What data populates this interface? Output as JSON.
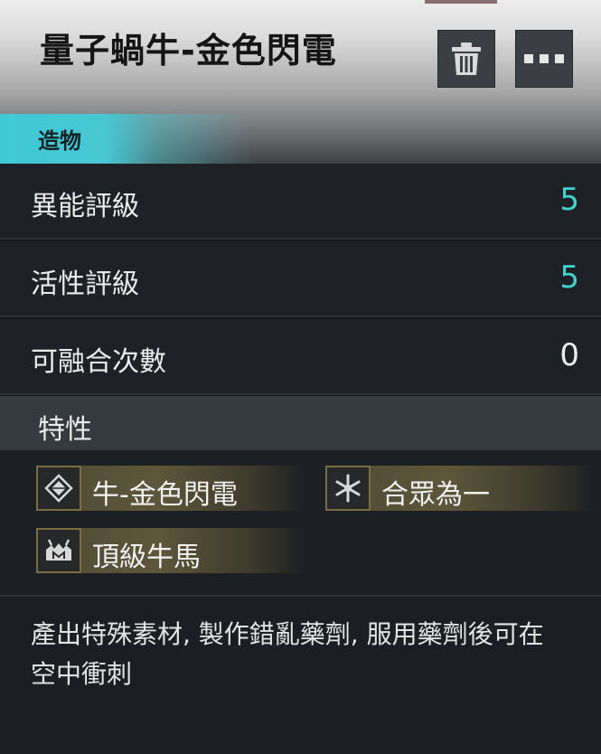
{
  "item": {
    "title": "量子蝸牛-金色閃電",
    "category": "造物"
  },
  "header_buttons": [
    {
      "name": "delete",
      "icon": "trash-icon"
    },
    {
      "name": "more",
      "icon": "more-dots-icon"
    }
  ],
  "stats": [
    {
      "label": "異能評級",
      "value": "5",
      "highlight": true
    },
    {
      "label": "活性評級",
      "value": "5",
      "highlight": true
    },
    {
      "label": "可融合次數",
      "value": "0",
      "highlight": false
    }
  ],
  "traits": {
    "heading": "特性",
    "items": [
      {
        "label": "牛-金色閃電",
        "icon": "diamond-icon"
      },
      {
        "label": "合眾為一",
        "icon": "snowflake-icon"
      },
      {
        "label": "頂級牛馬",
        "icon": "cow-icon"
      }
    ]
  },
  "description": "產出特殊素材, 製作錯亂藥劑, 服用藥劑後可在空中衝刺",
  "colors": {
    "accent_teal": "#43d3cf",
    "trait_chip_gold": "#5d563a",
    "background": "#1e2226"
  }
}
